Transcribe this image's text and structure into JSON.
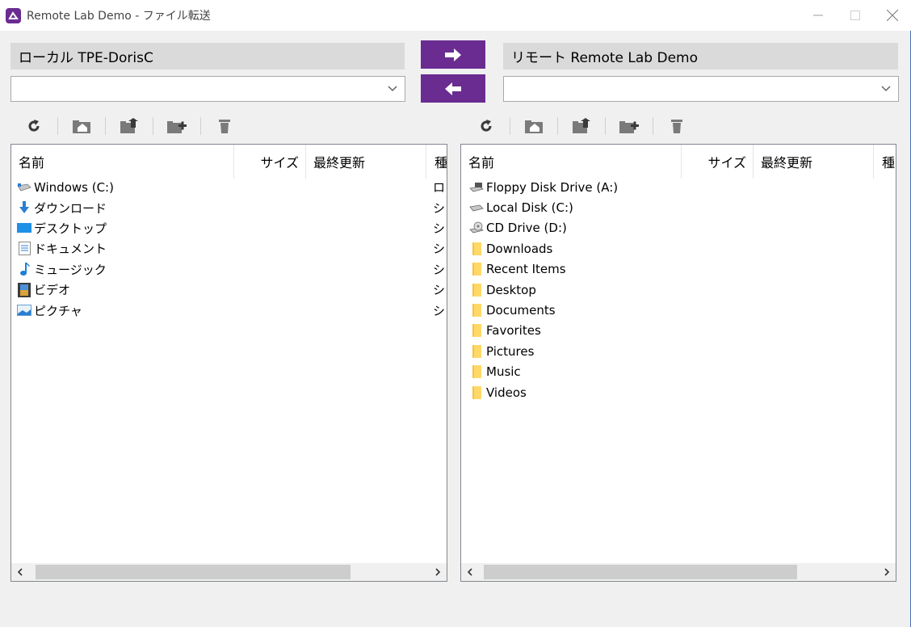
{
  "window": {
    "title": "Remote Lab Demo - ファイル転送",
    "minimize": "—",
    "maximize": "☐",
    "close": "✕"
  },
  "local": {
    "header": "ローカル  TPE-DorisC",
    "combo_value": "",
    "columns": {
      "name": "名前",
      "size": "サイズ",
      "modified": "最終更新",
      "type": "種"
    },
    "items": [
      {
        "name": "Windows (C:)",
        "icon": "drive-icon",
        "type": "ロ"
      },
      {
        "name": "ダウンロード",
        "icon": "download-icon",
        "type": "シ"
      },
      {
        "name": "デスクトップ",
        "icon": "desktop-icon",
        "type": "シ"
      },
      {
        "name": "ドキュメント",
        "icon": "documents-icon",
        "type": "シ"
      },
      {
        "name": "ミュージック",
        "icon": "music-icon",
        "type": "シ"
      },
      {
        "name": "ビデオ",
        "icon": "video-icon",
        "type": "シ"
      },
      {
        "name": "ピクチャ",
        "icon": "pictures-icon",
        "type": "シ"
      }
    ]
  },
  "remote": {
    "header": "リモート  Remote Lab Demo",
    "combo_value": "",
    "columns": {
      "name": "名前",
      "size": "サイズ",
      "modified": "最終更新",
      "type": "種"
    },
    "items": [
      {
        "name": "Floppy Disk Drive (A:)",
        "icon": "floppy-icon"
      },
      {
        "name": "Local Disk (C:)",
        "icon": "drive-icon"
      },
      {
        "name": "CD Drive (D:)",
        "icon": "cd-icon"
      },
      {
        "name": "Downloads",
        "icon": "folder-icon"
      },
      {
        "name": "Recent Items",
        "icon": "folder-icon"
      },
      {
        "name": "Desktop",
        "icon": "folder-icon"
      },
      {
        "name": "Documents",
        "icon": "folder-icon"
      },
      {
        "name": "Favorites",
        "icon": "folder-icon"
      },
      {
        "name": "Pictures",
        "icon": "folder-icon"
      },
      {
        "name": "Music",
        "icon": "folder-icon"
      },
      {
        "name": "Videos",
        "icon": "folder-icon"
      }
    ]
  },
  "transfer": {
    "to_remote": "arrow-right-icon",
    "to_local": "arrow-left-icon"
  },
  "toolbar_icons": [
    "refresh-icon",
    "home-icon",
    "parent-folder-icon",
    "new-folder-icon",
    "delete-icon"
  ],
  "colors": {
    "accent": "#6a2c91",
    "header_bg": "#dadada",
    "window_bg": "#f0f0f0"
  }
}
